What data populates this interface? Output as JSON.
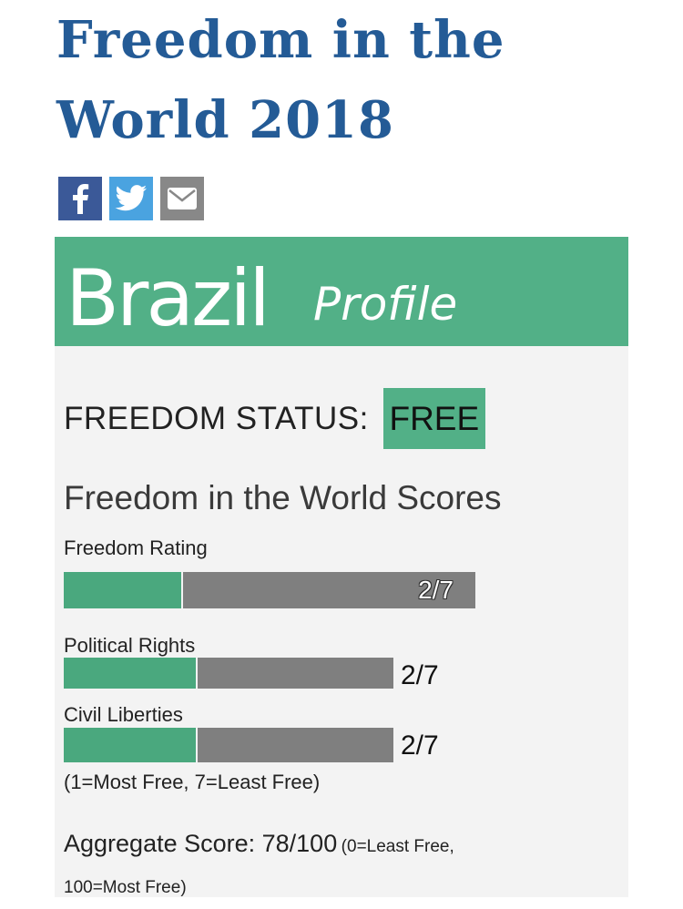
{
  "page": {
    "title_line1": "Freedom in the",
    "title_line2": "World 2018"
  },
  "share": {
    "icons": [
      "facebook-icon",
      "twitter-icon",
      "email-icon"
    ],
    "colors": {
      "facebook": "#3b5998",
      "twitter": "#4aa3e0",
      "email": "#888888"
    }
  },
  "profile": {
    "country": "Brazil",
    "profile_word": "Profile",
    "header_color": "#52b087",
    "status_label": "FREEDOM STATUS:",
    "status_value": "FREE",
    "scores_heading": "Freedom in the World Scores",
    "freedom_rating": {
      "label": "Freedom Rating",
      "value": "2/7",
      "fill_fraction": 0.2857
    },
    "political_rights": {
      "label": "Political Rights",
      "value": "2/7",
      "fill_fraction": 0.4
    },
    "civil_liberties": {
      "label": "Civil Liberties",
      "value": "2/7",
      "fill_fraction": 0.4
    },
    "scale_note": "(1=Most Free, 7=Least Free)",
    "aggregate_label": "Aggregate Score: 78/100",
    "aggregate_note": "(0=Least Free, 100=Most Free)"
  }
}
